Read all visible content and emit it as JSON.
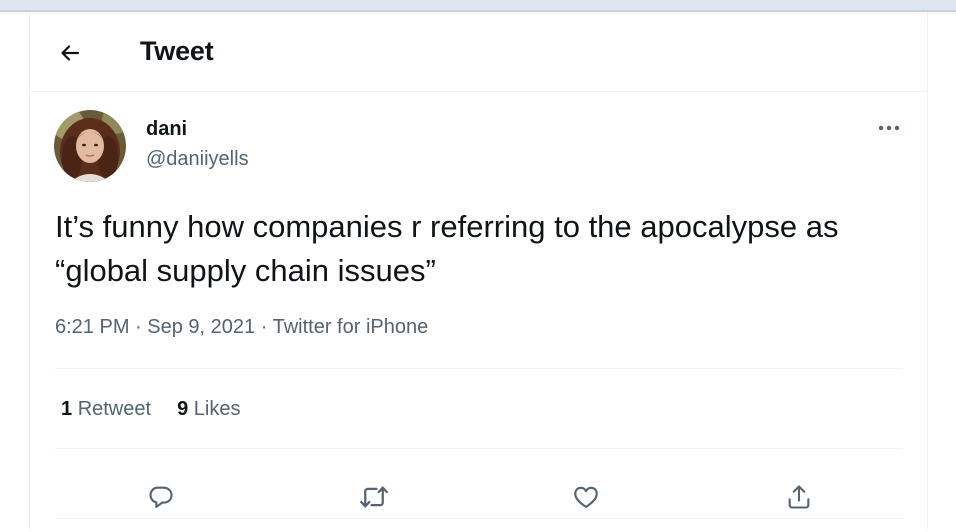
{
  "header": {
    "title": "Tweet",
    "back_icon": "arrow-left-icon"
  },
  "tweet": {
    "author_name": "dani",
    "author_handle": "@daniiyells",
    "text": "It’s funny how companies r referring to the apocalypse as “global supply chain issues”",
    "time": "6:21 PM",
    "date": "Sep 9, 2021",
    "source": "Twitter for iPhone",
    "separator": "·",
    "stats": {
      "retweets_count": "1",
      "retweets_label": "Retweet",
      "likes_count": "9",
      "likes_label": "Likes"
    },
    "actions": [
      "reply-icon",
      "retweet-icon",
      "like-icon",
      "share-icon"
    ]
  },
  "colors": {
    "text": "#0f1419",
    "secondary": "#536471",
    "border": "#eff3f4",
    "topbar": "#dde6f1"
  }
}
